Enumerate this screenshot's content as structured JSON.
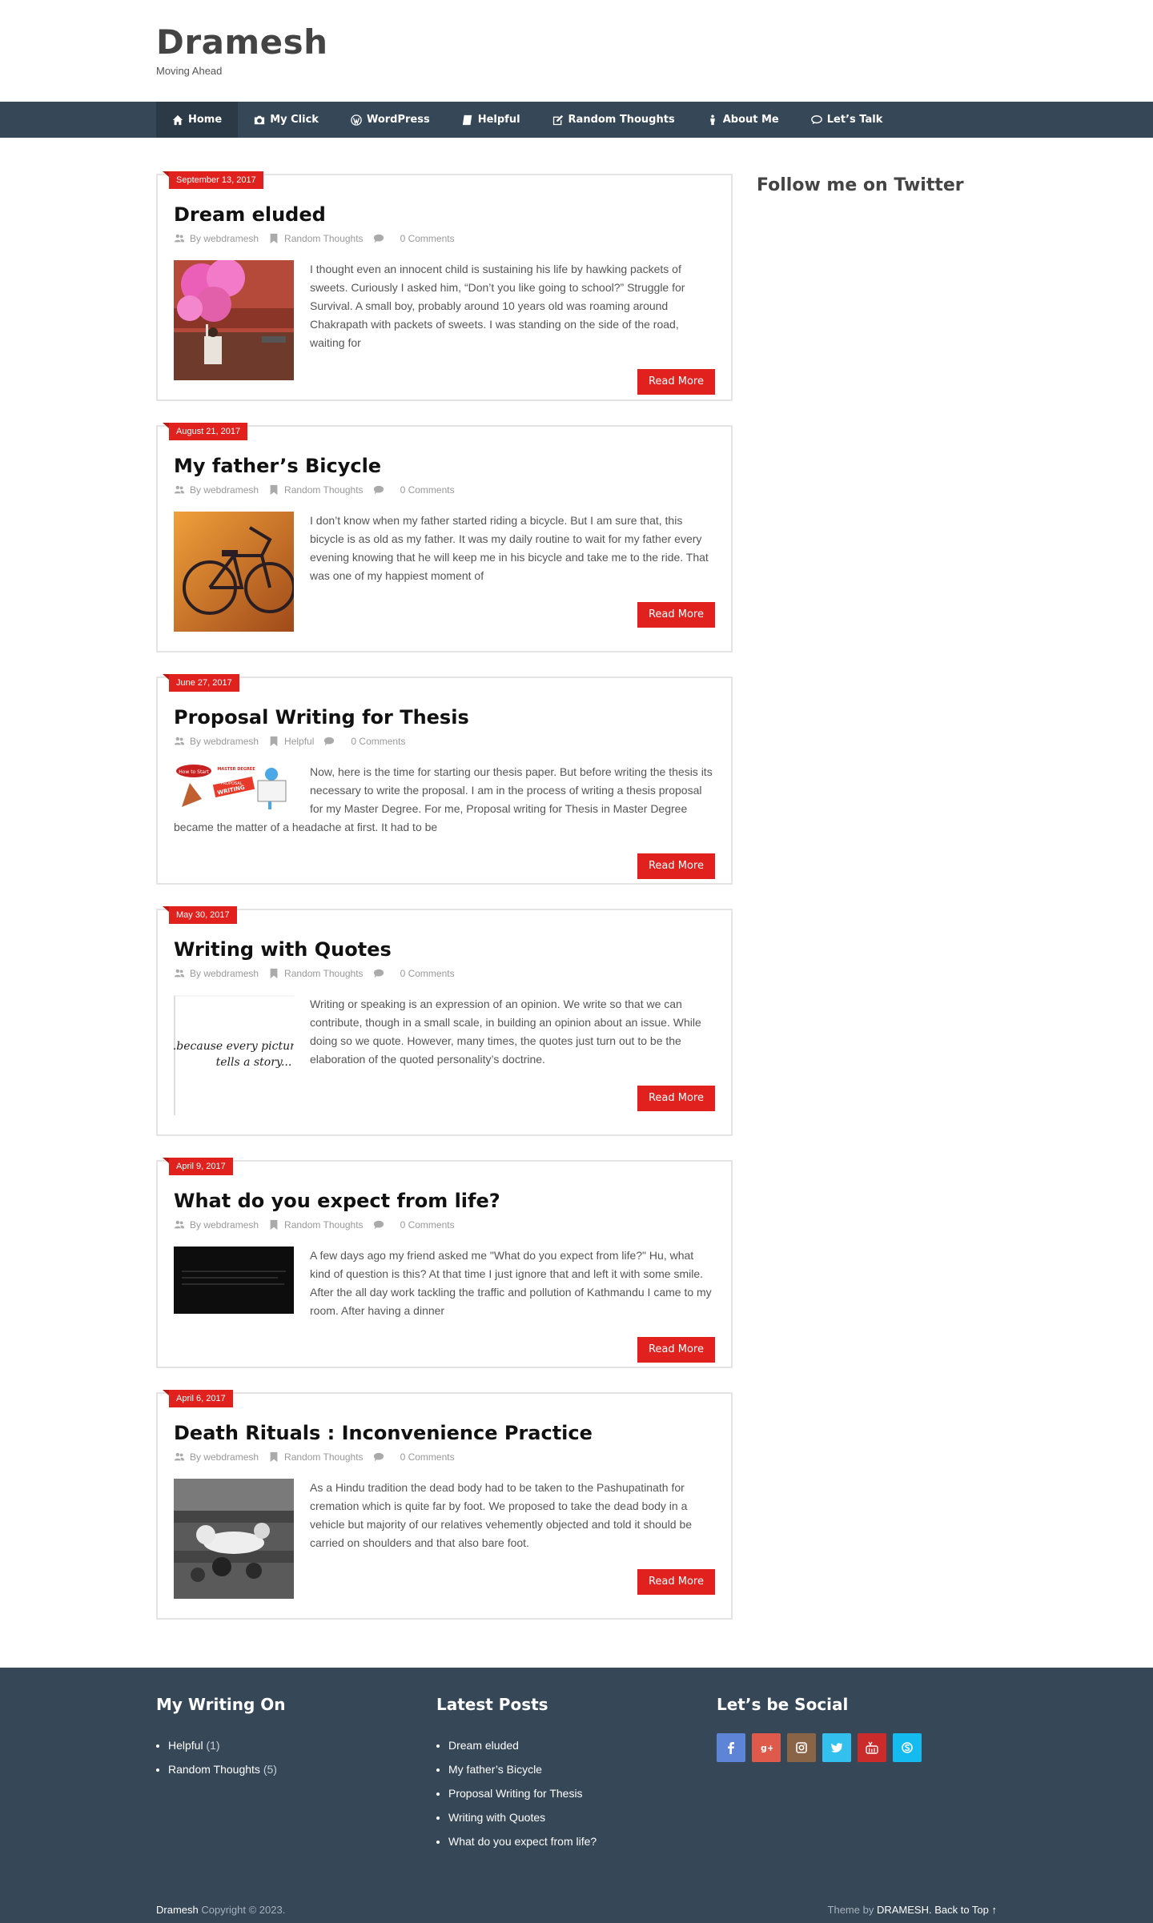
{
  "site": {
    "title": "Dramesh",
    "tagline": "Moving Ahead"
  },
  "nav": [
    {
      "label": "Home",
      "icon": "home-icon",
      "active": true
    },
    {
      "label": "My Click",
      "icon": "camera-icon"
    },
    {
      "label": "WordPress",
      "icon": "wordpress-icon"
    },
    {
      "label": "Helpful",
      "icon": "book-icon"
    },
    {
      "label": "Random Thoughts",
      "icon": "edit-icon"
    },
    {
      "label": "About Me",
      "icon": "person-icon"
    },
    {
      "label": "Let’s Talk",
      "icon": "chat-icon"
    }
  ],
  "posts": [
    {
      "date": "September 13, 2017",
      "title": "Dream eluded",
      "author": "By webdramesh",
      "category": "Random Thoughts",
      "comments": "0 Comments",
      "excerpt": " I thought even an innocent child is sustaining his life by hawking packets of sweets. Curiously I asked him, “Don’t you like going to school?”   Struggle for Survival. A small boy, probably around 10 years old was roaming around Chakrapath with packets of sweets. I was standing on the side of the road, waiting for",
      "read_more": "Read More"
    },
    {
      "date": "August 21, 2017",
      "title": "My father’s Bicycle",
      "author": "By webdramesh",
      "category": "Random Thoughts",
      "comments": "0 Comments",
      "excerpt": "I don’t know when my father started riding a bicycle. But I am sure that, this bicycle is as old as my father. It was my daily routine to wait for my father every evening knowing that he will keep me in his bicycle and take me to the ride. That was one of my happiest moment of",
      "read_more": "Read More"
    },
    {
      "date": "June 27, 2017",
      "title": "Proposal Writing for Thesis",
      "author": "By webdramesh",
      "category": "Helpful",
      "comments": "0 Comments",
      "excerpt": "Now, here is the time for starting our thesis paper. But before writing the thesis its necessary to write the proposal. I am in the process of writing a thesis proposal for my Master Degree. For me, Proposal writing for Thesis in Master Degree became the matter of a headache at first. It had to be",
      "read_more": "Read More",
      "thumb_labels": [
        "How to Start",
        "MASTER DEGREE",
        "PROPOSAL",
        "WRITING"
      ]
    },
    {
      "date": "May 30, 2017",
      "title": "Writing with Quotes",
      "author": "By webdramesh",
      "category": "Random Thoughts",
      "comments": "0 Comments",
      "excerpt": "Writing or speaking is an expression of an opinion. We write so that we can contribute, though in a small scale, in building an opinion about an issue. While doing so we quote. However, many times, the quotes just turn out to be the elaboration of the quoted personality’s doctrine.",
      "read_more": "Read More",
      "thumb_quote": [
        "...because every picture",
        "tells a story..."
      ]
    },
    {
      "date": "April 9, 2017",
      "title": "What do you expect from life?",
      "author": "By webdramesh",
      "category": "Random Thoughts",
      "comments": "0 Comments",
      "excerpt": "A few days ago my friend asked me \"What do you expect from life?\" Hu, what kind of question is this? At that time I just ignore that and left it with some smile. After the all day work tackling the traffic and pollution of Kathmandu I came to my room. After having a dinner",
      "read_more": "Read More"
    },
    {
      "date": "April 6, 2017",
      "title": "Death Rituals : Inconvenience Practice",
      "author": "By webdramesh",
      "category": "Random Thoughts",
      "comments": "0 Comments",
      "excerpt": "As a Hindu tradition the dead body had to be taken to the Pashupatinath for cremation which is quite far by foot. We proposed to take the dead body in a vehicle but majority of our relatives vehemently objected and told it should be carried on shoulders and that also bare foot.",
      "read_more": "Read More"
    }
  ],
  "sidebar": {
    "twitter_title": "Follow me on Twitter"
  },
  "footer": {
    "writing_title": "My Writing On",
    "categories": [
      {
        "name": "Helpful",
        "count": "(1)"
      },
      {
        "name": "Random Thoughts",
        "count": "(5)"
      }
    ],
    "latest_title": "Latest Posts",
    "latest": [
      "Dream eluded",
      "My father’s Bicycle",
      "Proposal Writing for Thesis",
      "Writing with Quotes",
      "What do you expect from life?"
    ],
    "social_title": "Let’s be Social",
    "socials": [
      {
        "name": "facebook-icon",
        "color": "#5d84d6"
      },
      {
        "name": "google-plus-icon",
        "color": "#e05a4b"
      },
      {
        "name": "instagram-icon",
        "color": "#8a6446"
      },
      {
        "name": "twitter-icon",
        "color": "#33c0ee"
      },
      {
        "name": "youtube-icon",
        "color": "#cc2b2b"
      },
      {
        "name": "skype-icon",
        "color": "#14bbf0"
      }
    ],
    "copyright_name": "Dramesh",
    "copyright_text": " Copyright © 2023.",
    "theme_by": "Theme by ",
    "theme_name": "DRAMESH",
    "back_to_top": ". Back to Top ↑"
  }
}
